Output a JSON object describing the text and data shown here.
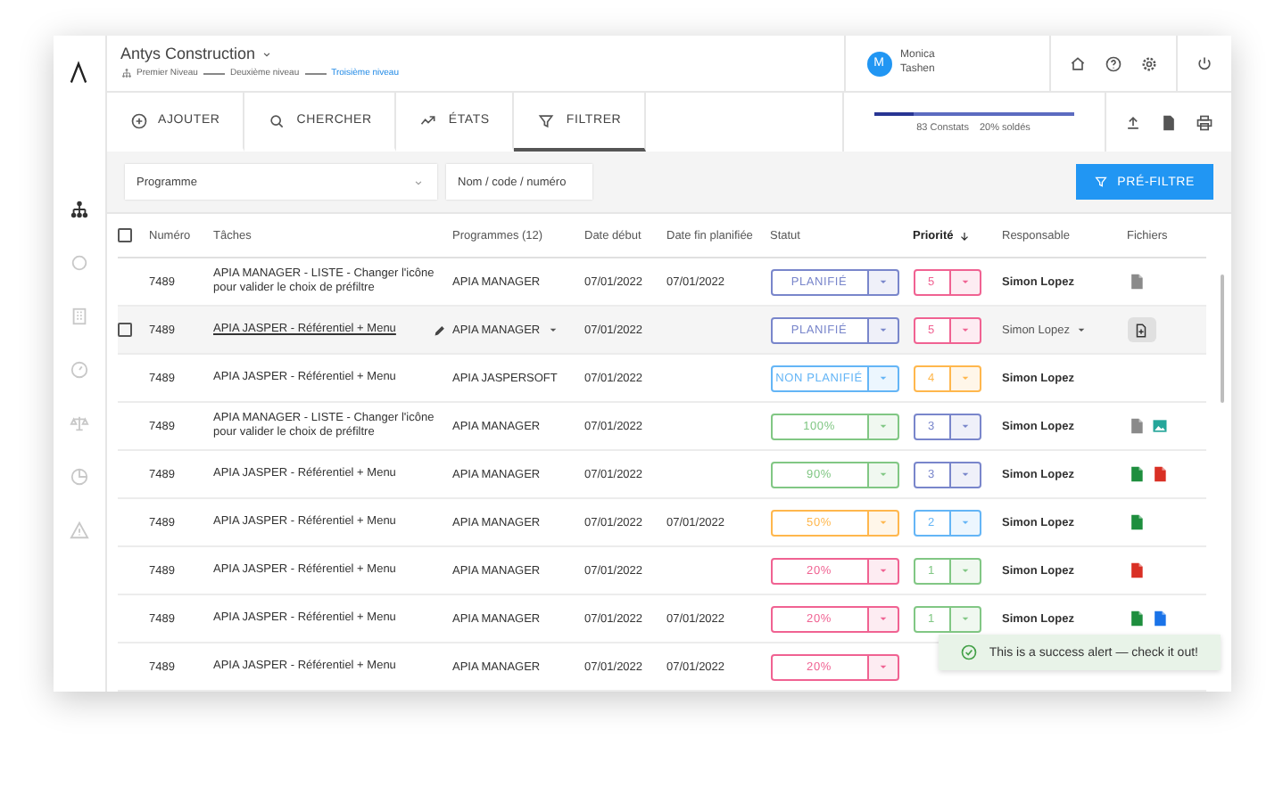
{
  "app": {
    "title": "Antys Construction",
    "breadcrumb": [
      {
        "label": "Premier Niveau",
        "current": false
      },
      {
        "label": "Deuxième niveau",
        "current": false
      },
      {
        "label": "Troisième niveau",
        "current": true
      }
    ]
  },
  "user": {
    "initial": "M",
    "name": "Monica Tashen"
  },
  "tabs": [
    {
      "label": "AJOUTER",
      "selected": false
    },
    {
      "label": "CHERCHER",
      "selected": false
    },
    {
      "label": "ÉTATS",
      "selected": false
    },
    {
      "label": "FILTRER",
      "selected": true
    }
  ],
  "progress": {
    "level": 0.2,
    "count": "83 Constats",
    "share": "20% soldés"
  },
  "sidebar": {
    "items": [
      {
        "selected": true
      },
      {
        "selected": false
      },
      {
        "selected": false
      },
      {
        "selected": false
      },
      {
        "selected": false
      },
      {
        "selected": false
      },
      {
        "selected": false
      }
    ]
  },
  "filters": {
    "programme": {
      "label": "Programme"
    },
    "search": {
      "placeholder": "Nom / code / numéro"
    },
    "button": "PRÉ-FILTRE"
  },
  "table": {
    "header_checkbox": {
      "checked": false
    },
    "columns": [
      {
        "label": "Numéro",
        "sorted": false
      },
      {
        "label": "Tâches",
        "sorted": false
      },
      {
        "label": "Programmes (12)",
        "sorted": false
      },
      {
        "label": "Date début",
        "sorted": false
      },
      {
        "label": "Date fin planifiée",
        "sorted": false
      },
      {
        "label": "Statut",
        "sorted": false
      },
      {
        "label": "Priorité",
        "sorted": true
      },
      {
        "label": "Responsable",
        "sorted": false
      },
      {
        "label": "Fichiers",
        "sorted": false
      }
    ],
    "rows": [
      {
        "number": "7489",
        "task": "APIA MANAGER - LISTE - Changer l'icône pour valider le choix de préfiltre",
        "program": "APIA MANAGER",
        "start": "07/01/2022",
        "end": "07/01/2022",
        "status": {
          "label": "PLANIFIÉ",
          "color": "#7986cb"
        },
        "priority": {
          "label": "5",
          "color": "#f06292"
        },
        "owner": "Simon Lopez",
        "files": [
          {
            "kind": "doc"
          }
        ],
        "hovered": false,
        "checked": false
      },
      {
        "number": "7489",
        "task": "APIA JASPER - Référentiel + Menu",
        "program": "APIA MANAGER",
        "start": "07/01/2022",
        "status": {
          "label": "PLANIFIÉ",
          "color": "#7986cb"
        },
        "priority": {
          "label": "5",
          "color": "#f06292"
        },
        "owner": "Simon Lopez",
        "files": [],
        "hovered": true,
        "checked": false
      },
      {
        "number": "7489",
        "task": "APIA JASPER - Référentiel + Menu",
        "program": "APIA JASPERSOFT",
        "start": "07/01/2022",
        "status": {
          "label": "NON PLANIFIÉ",
          "color": "#64b5f6"
        },
        "priority": {
          "label": "4",
          "color": "#ffb74d"
        },
        "owner": "Simon Lopez",
        "files": [],
        "hovered": false,
        "checked": false
      },
      {
        "number": "7489",
        "task": "APIA MANAGER - LISTE - Changer l'icône pour valider le choix de préfiltre",
        "program": "APIA MANAGER",
        "start": "07/01/2022",
        "status": {
          "label": "100%",
          "color": "#81c784"
        },
        "priority": {
          "label": "3",
          "color": "#7986cb"
        },
        "owner": "Simon Lopez",
        "files": [
          {
            "kind": "doc"
          },
          {
            "kind": "image"
          }
        ],
        "hovered": false,
        "checked": false
      },
      {
        "number": "7489",
        "task": "APIA JASPER - Référentiel + Menu",
        "program": "APIA MANAGER",
        "start": "07/01/2022",
        "status": {
          "label": "90%",
          "color": "#81c784"
        },
        "priority": {
          "label": "3",
          "color": "#7986cb"
        },
        "owner": "Simon Lopez",
        "files": [
          {
            "kind": "sheet"
          },
          {
            "kind": "slides"
          }
        ],
        "hovered": false,
        "checked": false
      },
      {
        "number": "7489",
        "task": "APIA JASPER - Référentiel + Menu",
        "program": "APIA MANAGER",
        "start": "07/01/2022",
        "end": "07/01/2022",
        "status": {
          "label": "50%",
          "color": "#ffb74d"
        },
        "priority": {
          "label": "2",
          "color": "#64b5f6"
        },
        "owner": "Simon Lopez",
        "files": [
          {
            "kind": "sheet"
          }
        ],
        "hovered": false,
        "checked": false
      },
      {
        "number": "7489",
        "task": "APIA JASPER - Référentiel + Menu",
        "program": "APIA MANAGER",
        "start": "07/01/2022",
        "status": {
          "label": "20%",
          "color": "#f06292"
        },
        "priority": {
          "label": "1",
          "color": "#81c784"
        },
        "owner": "Simon Lopez",
        "files": [
          {
            "kind": "pdf"
          }
        ],
        "hovered": false,
        "checked": false
      },
      {
        "number": "7489",
        "task": "APIA JASPER - Référentiel + Menu",
        "program": "APIA MANAGER",
        "start": "07/01/2022",
        "end": "07/01/2022",
        "status": {
          "label": "20%",
          "color": "#f06292"
        },
        "priority": {
          "label": "1",
          "color": "#81c784"
        },
        "owner": "Simon Lopez",
        "files": [
          {
            "kind": "sheet"
          },
          {
            "kind": "text"
          }
        ],
        "hovered": false,
        "checked": false
      },
      {
        "number": "7489",
        "task": "APIA JASPER - Référentiel + Menu",
        "program": "APIA MANAGER",
        "start": "07/01/2022",
        "end": "07/01/2022",
        "status": {
          "label": "20%",
          "color": "#f06292"
        },
        "hovered": false,
        "checked": false
      }
    ]
  },
  "alert": {
    "text": "This is a success alert — check it out!"
  }
}
